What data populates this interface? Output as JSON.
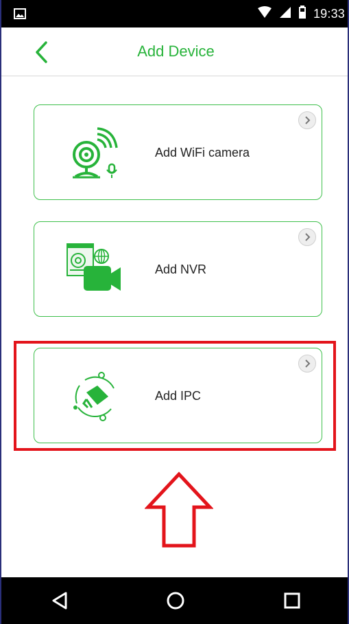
{
  "status_bar": {
    "time": "19:33"
  },
  "header": {
    "title": "Add Device"
  },
  "cards": [
    {
      "label": "Add WiFi camera"
    },
    {
      "label": "Add NVR"
    },
    {
      "label": "Add IPC"
    }
  ],
  "colors": {
    "accent": "#27b33a",
    "highlight": "#e3141b"
  },
  "icons": {
    "back": "chevron-left-icon",
    "card_arrow": "chevron-right-icon",
    "wifi_camera": "wifi-camera-icon",
    "nvr": "nvr-icon",
    "ipc": "ipc-camera-icon"
  }
}
